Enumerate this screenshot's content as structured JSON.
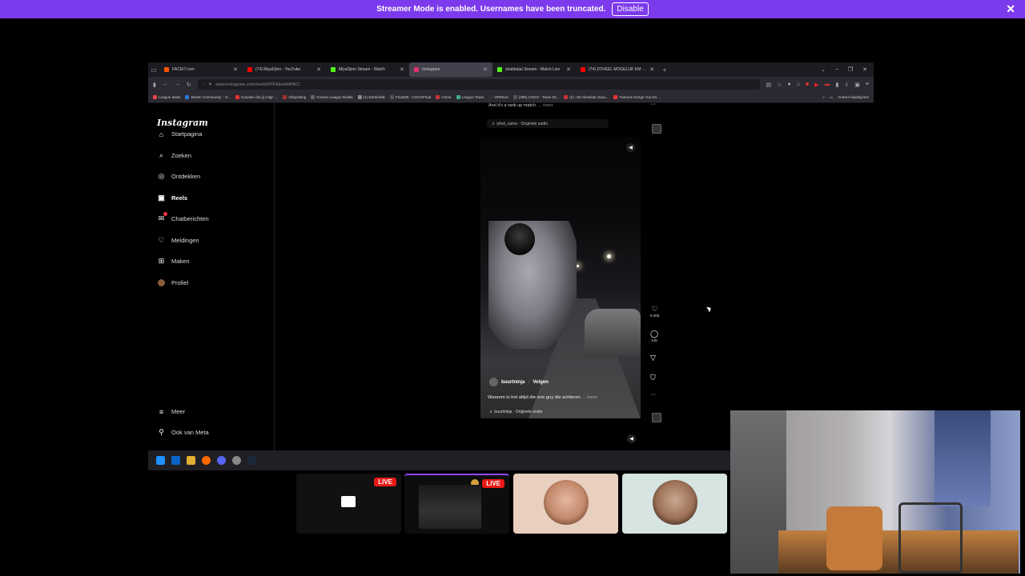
{
  "banner": {
    "message": "Streamer Mode is enabled. Usernames have been truncated.",
    "button": "Disable"
  },
  "tabs": [
    {
      "label": "FACEIT.com",
      "color": "#ff5500",
      "active": false
    },
    {
      "label": "(74) MiyaDjinn - YouTube",
      "color": "#ff0000",
      "active": false
    },
    {
      "label": "MiyaDjinn Stream - Watch",
      "color": "#53fc18",
      "active": false
    },
    {
      "label": "Instagram",
      "color": "#e1306c",
      "active": true
    },
    {
      "label": "shabbatai Stream - Watch Live",
      "color": "#53fc18",
      "active": false
    },
    {
      "label": "(74) ZOVEEL MOGELIJK KM HA",
      "color": "#ff0000",
      "active": false
    }
  ],
  "url": "www.instagram.com/reels/DPFAEwhRPAC/",
  "bookmarks": [
    "League leaks",
    "Steam Community :: S...",
    "Kanalen die jij volgt -...",
    "shitposting",
    "Korean League Builds",
    "(1) Darkinfolk",
    "FloatDB - CSGOFloat",
    "Home",
    "League Team",
    "OPENAI",
    "(296) CSGO - Team Dr...",
    "(2) +20 Absolute Savu...",
    "Famous Songs You Do..."
  ],
  "bookmarks_other": "Andere bladwijzers",
  "instagram": {
    "logo": "Instagram",
    "nav": [
      {
        "label": "Startpagina",
        "icon": "home-icon",
        "glyph": "⌂"
      },
      {
        "label": "Zoeken",
        "icon": "search-icon",
        "glyph": "⌕"
      },
      {
        "label": "Ontdekken",
        "icon": "compass-icon",
        "glyph": "◎"
      },
      {
        "label": "Reels",
        "icon": "reels-icon",
        "glyph": "▣"
      },
      {
        "label": "Chatberichten",
        "icon": "messenger-icon",
        "glyph": "✉"
      },
      {
        "label": "Meldingen",
        "icon": "heart-icon",
        "glyph": "♡"
      },
      {
        "label": "Maken",
        "icon": "create-icon",
        "glyph": "⊞"
      },
      {
        "label": "Profiel",
        "icon": "profile-avatar",
        "glyph": ""
      }
    ],
    "more": "Meer",
    "meta": "Ook van Meta",
    "prev_caption": "And it's a rank up match.",
    "prev_more": "... meer",
    "prev_audio": "♬ iyhot_sama · Originele audio",
    "reel": {
      "username": "buurtninja",
      "follow": "Volgen",
      "caption": "Waarom is het altijd die ene guy die achteren",
      "caption_more": "... meer",
      "audio": "♬ buurtninja · Originele audio",
      "likes": "8.305",
      "comments": "145"
    }
  },
  "live_label": "LIVE"
}
